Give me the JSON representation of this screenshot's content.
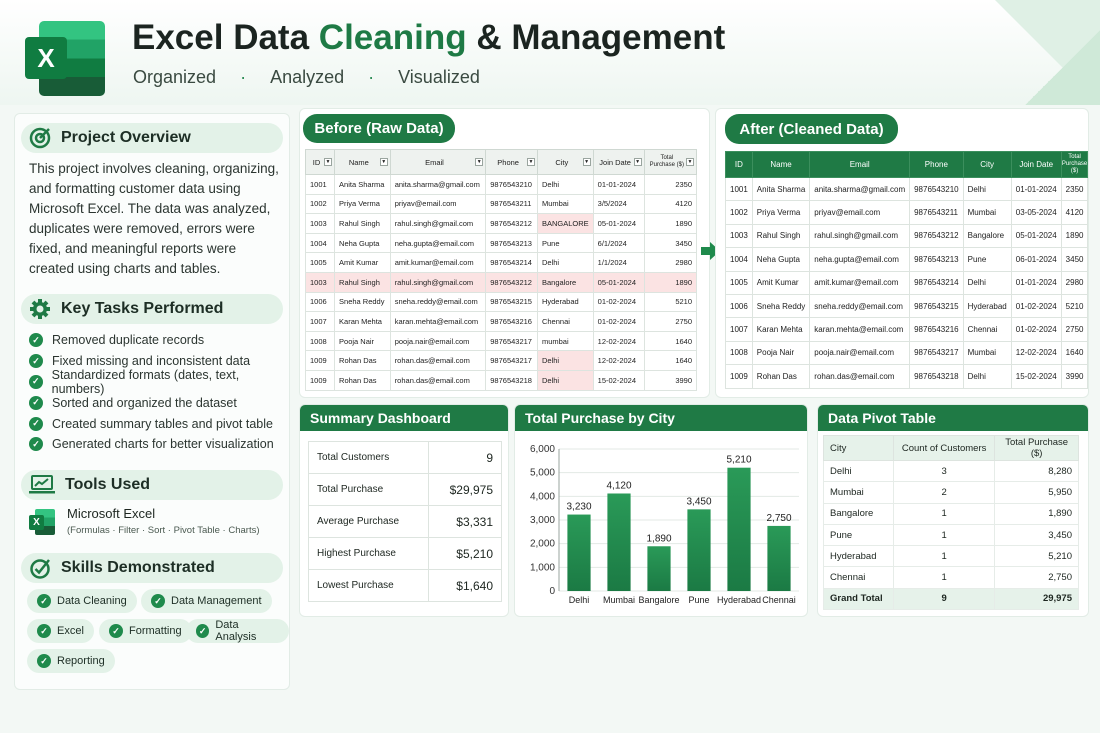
{
  "header": {
    "title_part1": "Excel Data",
    "title_part2": "Cleaning",
    "title_part3": "& Management",
    "subtitle": [
      "Organized",
      "Analyzed",
      "Visualized"
    ],
    "logo_letter": "X"
  },
  "overview": {
    "heading": "Project Overview",
    "text": "This project involves cleaning, organizing, and formatting customer data using Microsoft Excel. The data was analyzed, duplicates were removed, errors were fixed, and meaningful reports were created using charts and tables."
  },
  "tasks": {
    "heading": "Key Tasks Performed",
    "items": [
      "Removed duplicate records",
      "Fixed missing and inconsistent data",
      "Standardized formats (dates, text, numbers)",
      "Sorted and organized the dataset",
      "Created summary tables and pivot table",
      "Generated charts for better visualization"
    ]
  },
  "tools": {
    "heading": "Tools Used",
    "name": "Microsoft Excel",
    "desc": "(Formulas  ·  Filter · Sort · Pivot Table · Charts)"
  },
  "skills": {
    "heading": "Skills Demonstrated",
    "items": [
      "Data Cleaning",
      "Data Management",
      "Excel",
      "Formatting",
      "Data Analysis",
      "Reporting"
    ]
  },
  "raw": {
    "title": "Before (Raw Data)",
    "headers": [
      "ID",
      "Name",
      "Email",
      "Phone",
      "City",
      "Join Date",
      "Total Purchase ($)"
    ],
    "rows": [
      [
        "1001",
        "Anita Sharma",
        "anita.sharma@gmail.com",
        "9876543210",
        "Delhi",
        "01-01-2024",
        "2350"
      ],
      [
        "1002",
        "Priya Verma",
        "priyav@email.com",
        "9876543211",
        "Mumbai",
        "3/5/2024",
        "4120"
      ],
      [
        "1003",
        "Rahul Singh",
        "rahul.singh@gmail.com",
        "9876543212",
        "BANGALORE",
        "05-01-2024",
        "1890"
      ],
      [
        "1004",
        "Neha Gupta",
        "neha.gupta@email.com",
        "9876543213",
        "Pune",
        "6/1/2024",
        "3450"
      ],
      [
        "1005",
        "Amit Kumar",
        "amit.kumar@email.com",
        "9876543214",
        "Delhi",
        "1/1/2024",
        "2980"
      ],
      [
        "1003",
        "Rahul Singh",
        "rahul.singh@gmail.com",
        "9876543212",
        "Bangalore",
        "05-01-2024",
        "1890"
      ],
      [
        "1006",
        "Sneha Reddy",
        "sneha.reddy@email.com",
        "9876543215",
        "Hyderabad",
        "01-02-2024",
        "5210"
      ],
      [
        "1007",
        "Karan Mehta",
        "karan.mehta@email.com",
        "9876543216",
        "Chennai",
        "01-02-2024",
        "2750"
      ],
      [
        "1008",
        "Pooja Nair",
        "pooja.nair@email.com",
        "9876543217",
        "mumbai",
        "12-02-2024",
        "1640"
      ],
      [
        "1009",
        "Rohan Das",
        "rohan.das@email.com",
        "9876543217",
        "Delhi",
        "12-02-2024",
        "1640"
      ],
      [
        "1009",
        "Rohan Das",
        "rohan.das@email.com",
        "9876543218",
        "Delhi",
        "15-02-2024",
        "3990"
      ]
    ]
  },
  "clean": {
    "title": "After (Cleaned Data)",
    "headers": [
      "ID",
      "Name",
      "Email",
      "Phone",
      "City",
      "Join Date",
      "Total Purchase ($)"
    ],
    "rows": [
      [
        "1001",
        "Anita Sharma",
        "anita.sharma@gmail.com",
        "9876543210",
        "Delhi",
        "01-01-2024",
        "2350"
      ],
      [
        "1002",
        "Priya Verma",
        "priyav@email.com",
        "9876543211",
        "Mumbai",
        "03-05-2024",
        "4120"
      ],
      [
        "1003",
        "Rahul Singh",
        "rahul.singh@gmail.com",
        "9876543212",
        "Bangalore",
        "05-01-2024",
        "1890"
      ],
      [
        "1004",
        "Neha Gupta",
        "neha.gupta@email.com",
        "9876543213",
        "Pune",
        "06-01-2024",
        "3450"
      ],
      [
        "1005",
        "Amit Kumar",
        "amit.kumar@email.com",
        "9876543214",
        "Delhi",
        "01-01-2024",
        "2980"
      ],
      [
        "1006",
        "Sneha Reddy",
        "sneha.reddy@email.com",
        "9876543215",
        "Hyderabad",
        "01-02-2024",
        "5210"
      ],
      [
        "1007",
        "Karan Mehta",
        "karan.mehta@email.com",
        "9876543216",
        "Chennai",
        "01-02-2024",
        "2750"
      ],
      [
        "1008",
        "Pooja Nair",
        "pooja.nair@email.com",
        "9876543217",
        "Mumbai",
        "12-02-2024",
        "1640"
      ],
      [
        "1009",
        "Rohan Das",
        "rohan.das@email.com",
        "9876543218",
        "Delhi",
        "15-02-2024",
        "3990"
      ]
    ]
  },
  "summary": {
    "title": "Summary Dashboard",
    "rows": [
      [
        "Total Customers",
        "9"
      ],
      [
        "Total Purchase",
        "$29,975"
      ],
      [
        "Average Purchase",
        "$3,331"
      ],
      [
        "Highest Purchase",
        "$5,210"
      ],
      [
        "Lowest Purchase",
        "$1,640"
      ]
    ]
  },
  "pivot": {
    "title": "Data Pivot Table",
    "headers": [
      "City",
      "Count of Customers",
      "Total Purchase ($)"
    ],
    "rows": [
      [
        "Delhi",
        "3",
        "8,280"
      ],
      [
        "Mumbai",
        "2",
        "5,950"
      ],
      [
        "Bangalore",
        "1",
        "1,890"
      ],
      [
        "Pune",
        "1",
        "3,450"
      ],
      [
        "Hyderabad",
        "1",
        "5,210"
      ],
      [
        "Chennai",
        "1",
        "2,750"
      ]
    ],
    "total": [
      "Grand Total",
      "9",
      "29,975"
    ]
  },
  "chart_data": {
    "type": "bar",
    "title": "Total Purchase by City",
    "categories": [
      "Delhi",
      "Mumbai",
      "Bangalore",
      "Pune",
      "Hyderabad",
      "Chennai"
    ],
    "values": [
      3230,
      4120,
      1890,
      3450,
      5210,
      2750
    ],
    "labels": [
      "3,230",
      "4,120",
      "1,890",
      "3,450",
      "5,210",
      "2,750"
    ],
    "yticks": [
      "0",
      "1,000",
      "2,000",
      "3,000",
      "4,000",
      "5,000",
      "6,000"
    ],
    "ylim": [
      0,
      6000
    ],
    "xlabel": "",
    "ylabel": "",
    "bar_color": "#1f8a4c"
  }
}
